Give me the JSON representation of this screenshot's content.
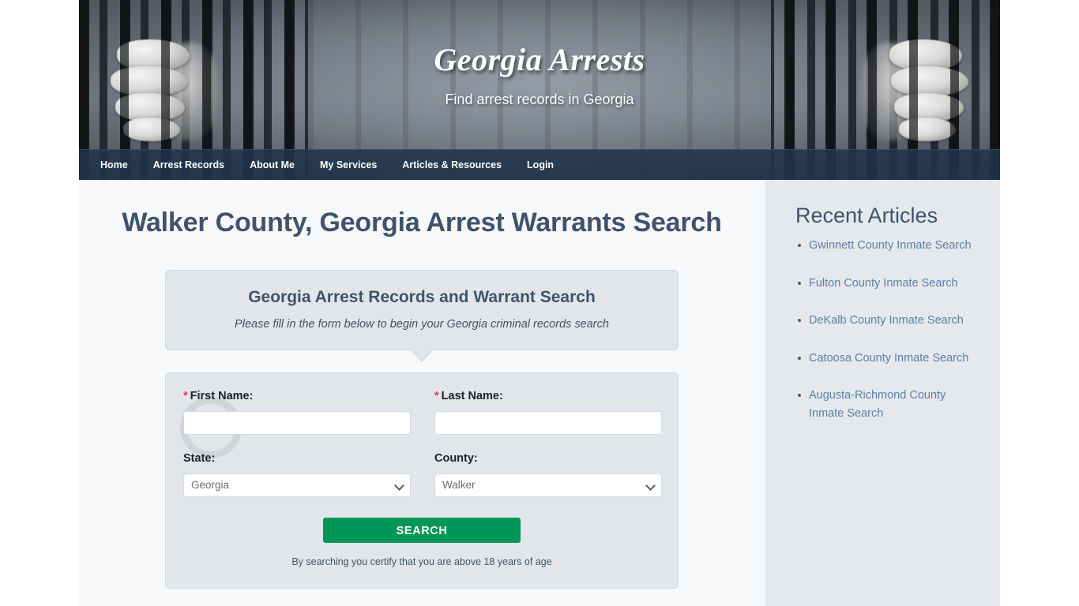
{
  "banner": {
    "title": "Georgia Arrests",
    "tagline": "Find arrest records in Georgia",
    "art_icon": "prison-bars-hands-image"
  },
  "nav": {
    "items": [
      {
        "label": "Home"
      },
      {
        "label": "Arrest Records"
      },
      {
        "label": "About Me"
      },
      {
        "label": "My Services"
      },
      {
        "label": "Articles & Resources"
      },
      {
        "label": "Login"
      }
    ]
  },
  "main": {
    "page_title": "Walker County, Georgia Arrest Warrants Search",
    "form_head": {
      "heading": "Georgia Arrest Records and Warrant Search",
      "subheading": "Please fill in the form below to begin your Georgia criminal records search"
    },
    "form": {
      "first_name": {
        "label": "First Name:",
        "required_mark": "*",
        "value": "",
        "placeholder": ""
      },
      "last_name": {
        "label": "Last Name:",
        "required_mark": "*",
        "value": "",
        "placeholder": ""
      },
      "state": {
        "label": "State:",
        "selected": "Georgia"
      },
      "county": {
        "label": "County:",
        "selected": "Walker"
      },
      "submit_label": "SEARCH",
      "disclaimer": "By searching you certify that you are above 18 years of age"
    }
  },
  "sidebar": {
    "title": "Recent Articles",
    "articles": [
      {
        "label": "Gwinnett County Inmate Search"
      },
      {
        "label": "Fulton County Inmate Search"
      },
      {
        "label": "DeKalb County Inmate Search"
      },
      {
        "label": "Catoosa County Inmate Search"
      },
      {
        "label": "Augusta-Richmond County Inmate Search"
      }
    ]
  },
  "colors": {
    "nav_bar": "#20344c",
    "heading_blue": "#3f536b",
    "link_blue": "#5b7fa6",
    "search_green": "#009657",
    "required_red": "#e03a4e",
    "panel_gray": "#e2e6ea",
    "sidebar_gray": "#e5e8ed",
    "main_bg": "#f7f8f9"
  }
}
